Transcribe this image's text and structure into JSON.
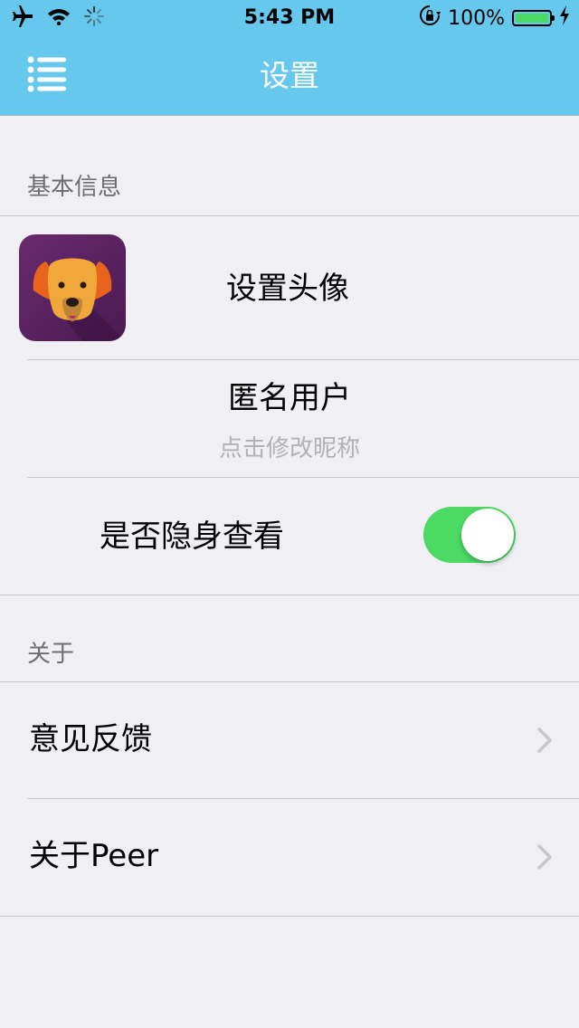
{
  "status_bar": {
    "time": "5:43 PM",
    "battery_percent": "100%",
    "battery_level": 1.0,
    "icons": [
      "airplane-icon",
      "wifi-icon",
      "activity-spinner-icon",
      "rotation-lock-icon",
      "battery-icon",
      "charging-bolt-icon"
    ]
  },
  "nav": {
    "title": "设置",
    "menu_icon": "menu-list-icon"
  },
  "sections": {
    "basic_info": {
      "header": "基本信息",
      "avatar_label": "设置头像",
      "nickname": "匿名用户",
      "nickname_hint": "点击修改昵称",
      "incognito_label": "是否隐身查看",
      "incognito_on": true
    },
    "about": {
      "header": "关于",
      "feedback_label": "意见反馈",
      "about_label": "关于Peer"
    }
  },
  "colors": {
    "nav_background": "#66c8ec",
    "page_background": "#efeff4",
    "toggle_on": "#4cd964",
    "avatar_background": "#5a2460",
    "dog_face": "#f0a83a",
    "dog_ears": "#e8641c"
  }
}
